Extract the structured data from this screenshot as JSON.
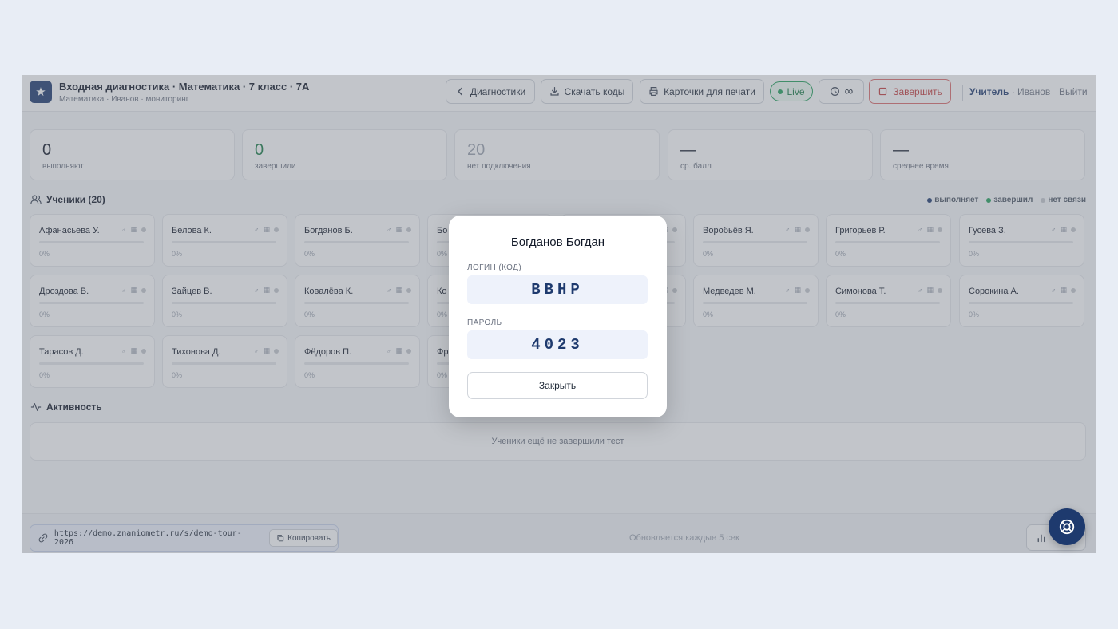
{
  "header": {
    "title": "Входная диагностика · Математика · 7 класс · 7А",
    "subtitle": "Математика · Иванов · мониторинг",
    "back_label": "Диагностики",
    "download_label": "Скачать коды",
    "print_label": "Карточки для печати",
    "live_label": "Live",
    "timer_label": "∞",
    "finish_label": "Завершить",
    "role": "Учитель",
    "user": "· Иванов",
    "logout": "Выйти"
  },
  "stats": [
    {
      "value": "0",
      "label": "выполняют",
      "color": "#111827"
    },
    {
      "value": "0",
      "label": "завершили",
      "color": "#157a43"
    },
    {
      "value": "20",
      "label": "нет подключения",
      "color": "#9ca3af"
    },
    {
      "value": "—",
      "label": "ср. балл",
      "color": "#111827"
    },
    {
      "value": "—",
      "label": "среднее время",
      "color": "#111827"
    }
  ],
  "students_section": {
    "title": "Ученики (20)",
    "legend": [
      {
        "label": "выполняет",
        "color": "#1e3a6e"
      },
      {
        "label": "завершил",
        "color": "#22a05a"
      },
      {
        "label": "нет связи",
        "color": "#c4c8ce"
      }
    ]
  },
  "students": [
    {
      "name": "Афанасьева У.",
      "progress": "0%",
      "progress_fraction": 0
    },
    {
      "name": "Белова К.",
      "progress": "0%",
      "progress_fraction": 0
    },
    {
      "name": "Богданов Б.",
      "progress": "0%",
      "progress_fraction": 0
    },
    {
      "name": "Бо",
      "progress": "0%",
      "progress_fraction": 0
    },
    {
      "name": "",
      "progress": "",
      "progress_fraction": 0
    },
    {
      "name": "Воробьёв Я.",
      "progress": "0%",
      "progress_fraction": 0
    },
    {
      "name": "Григорьев Р.",
      "progress": "0%",
      "progress_fraction": 0
    },
    {
      "name": "Гусева З.",
      "progress": "0%",
      "progress_fraction": 0
    },
    {
      "name": "Дроздова В.",
      "progress": "0%",
      "progress_fraction": 0
    },
    {
      "name": "Зайцев В.",
      "progress": "0%",
      "progress_fraction": 0
    },
    {
      "name": "Ковалёва К.",
      "progress": "0%",
      "progress_fraction": 0
    },
    {
      "name": "Ко",
      "progress": "0%",
      "progress_fraction": 0
    },
    {
      "name": "",
      "progress": "",
      "progress_fraction": 0
    },
    {
      "name": "Медведев М.",
      "progress": "0%",
      "progress_fraction": 0
    },
    {
      "name": "Симонова Т.",
      "progress": "0%",
      "progress_fraction": 0
    },
    {
      "name": "Сорокина А.",
      "progress": "0%",
      "progress_fraction": 0
    },
    {
      "name": "Тарасов Д.",
      "progress": "0%",
      "progress_fraction": 0
    },
    {
      "name": "Тихонова Д.",
      "progress": "0%",
      "progress_fraction": 0
    },
    {
      "name": "Фёдоров П.",
      "progress": "0%",
      "progress_fraction": 0
    },
    {
      "name": "Фр",
      "progress": "0%",
      "progress_fraction": 0
    }
  ],
  "activity": {
    "title": "Активность",
    "empty_text": "Ученики ещё не завершили тест"
  },
  "footer": {
    "url": "https://demo.znaniometr.ru/s/demo-tour-2026",
    "copy_label": "Копировать",
    "update_text": "Обновляется каждые 5 сек"
  },
  "modal": {
    "title": "Богданов Богдан",
    "login_label": "ЛОГИН (КОД)",
    "login_value": "BBHP",
    "password_label": "ПАРОЛЬ",
    "password_value": "4023",
    "close_label": "Закрыть"
  },
  "colors": {
    "brand": "#1e3a6e",
    "live": "#22a05a",
    "danger": "#c43b3b"
  }
}
